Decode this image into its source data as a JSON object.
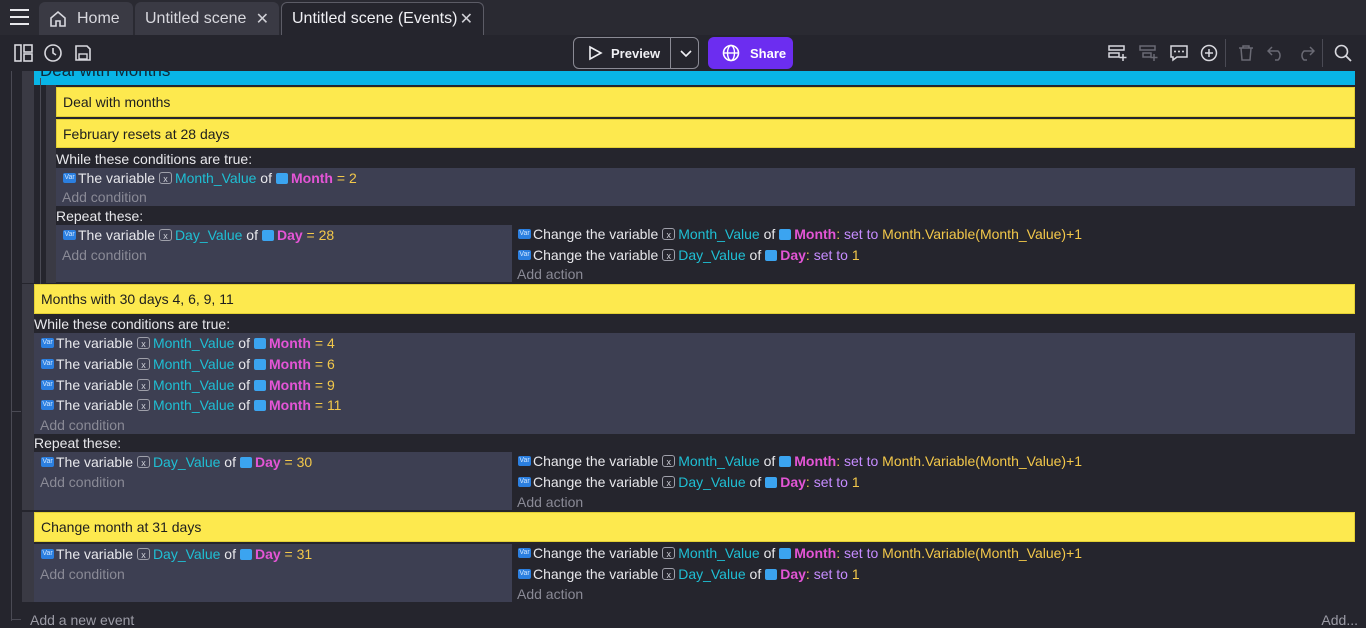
{
  "tabs": [
    {
      "label": "Home"
    },
    {
      "label": "Untitled scene"
    },
    {
      "label": "Untitled scene (Events)"
    }
  ],
  "toolbar": {
    "preview_label": "Preview",
    "share_label": "Share"
  },
  "group_title": "Deal with Months",
  "comments": {
    "c1": "Deal with months",
    "c2": "February resets at 28 days",
    "c3": "Months with 30 days 4, 6, 9, 11",
    "c4": "Change month at 31 days"
  },
  "labels": {
    "while": "While these conditions are true:",
    "repeat": "Repeat these:",
    "add_condition": "Add condition",
    "add_action": "Add action",
    "the_variable": "The variable",
    "of": "of",
    "change_the_variable": "Change the variable",
    "set_to": "set to",
    "eq": "=",
    "colon": ":",
    "add_event": "Add a new event",
    "add_more": "Add..."
  },
  "vars": {
    "month_value": "Month_Value",
    "day_value": "Day_Value"
  },
  "objs": {
    "month": "Month",
    "day": "Day"
  },
  "values": {
    "v2": "2",
    "v28": "28",
    "v4": "4",
    "v6": "6",
    "v9": "9",
    "v11": "11",
    "v30": "30",
    "v31": "31",
    "v1": "1",
    "expr": "Month.Variable(Month_Value)+1"
  },
  "colors": {
    "accent": "#6c2df0",
    "group": "#08b5e6",
    "comment": "#fde94e",
    "condition_bg": "#3d3f52"
  }
}
